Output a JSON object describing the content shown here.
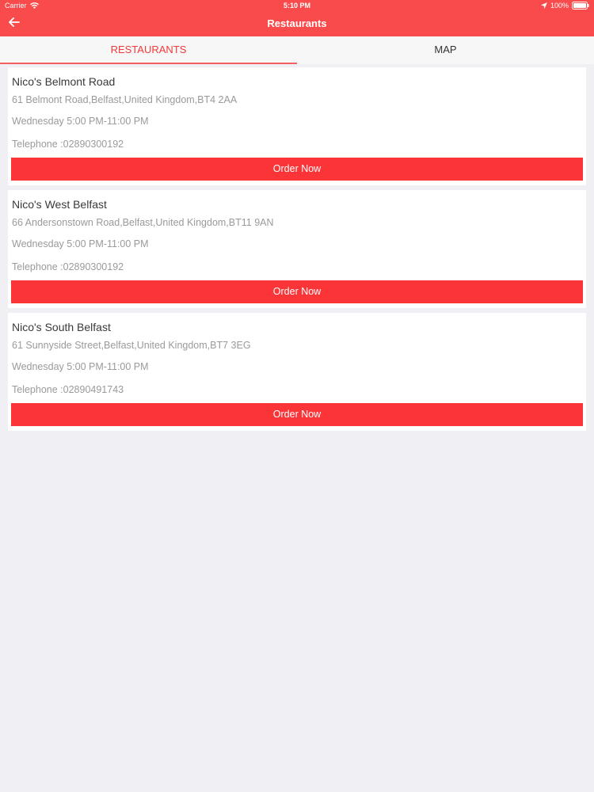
{
  "status_bar": {
    "carrier": "Carrier",
    "time": "5:10 PM",
    "battery": "100%"
  },
  "nav": {
    "title": "Restaurants",
    "back_icon": "arrow-left-icon"
  },
  "tabs": [
    {
      "label": "RESTAURANTS",
      "active": true
    },
    {
      "label": "MAP",
      "active": false
    }
  ],
  "restaurants": [
    {
      "name": "Nico's Belmont Road",
      "address": "61 Belmont Road,Belfast,United Kingdom,BT4 2AA",
      "hours": "Wednesday 5:00 PM-11:00 PM",
      "phone": "Telephone :02890300192",
      "order_label": "Order Now"
    },
    {
      "name": "Nico's West Belfast",
      "address": "66 Andersonstown Road,Belfast,United Kingdom,BT11 9AN",
      "hours": "Wednesday 5:00 PM-11:00 PM",
      "phone": "Telephone :02890300192",
      "order_label": "Order Now"
    },
    {
      "name": "Nico's South Belfast",
      "address": "61 Sunnyside Street,Belfast,United Kingdom,BT7 3EG",
      "hours": "Wednesday 5:00 PM-11:00 PM",
      "phone": "Telephone :02890491743",
      "order_label": "Order Now"
    }
  ],
  "colors": {
    "brand": "#f94b4b",
    "button": "#fb3438",
    "active_tab": "#f13a3a",
    "background": "#efeff4"
  }
}
